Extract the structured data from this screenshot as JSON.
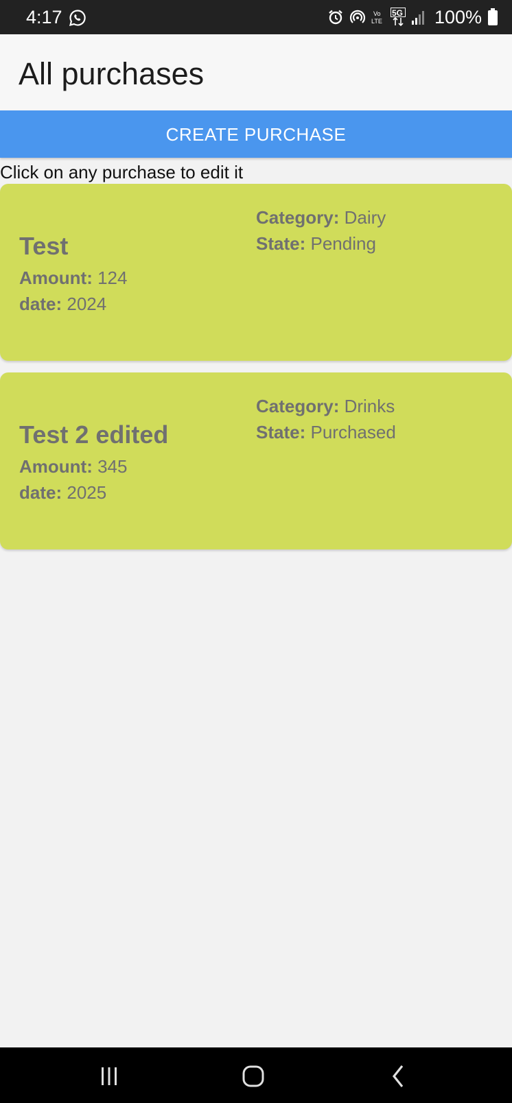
{
  "status_bar": {
    "time": "4:17",
    "battery_text": "100%",
    "icons": [
      "whatsapp-icon",
      "alarm-icon",
      "hotspot-icon",
      "volte-icon",
      "5g-icon",
      "signal-icon",
      "battery-icon"
    ]
  },
  "header": {
    "title": "All purchases"
  },
  "actions": {
    "create_label": "CREATE PURCHASE"
  },
  "hint": "Click on any purchase to edit it",
  "labels": {
    "amount": "Amount:",
    "date": "date:",
    "category": "Category:",
    "state": "State:"
  },
  "purchases": [
    {
      "name": "Test",
      "amount": "124",
      "date": "2024",
      "category": "Dairy",
      "state": "Pending"
    },
    {
      "name": "Test 2 edited",
      "amount": "345",
      "date": "2025",
      "category": "Drinks",
      "state": "Purchased"
    }
  ],
  "colors": {
    "status_bar": "#222222",
    "app_bar": "#f7f7f7",
    "accent_button": "#4a96ee",
    "card_background": "#d0dc5a",
    "card_text": "#707070",
    "page_background": "#f2f2f2"
  },
  "nav_bar": {
    "icons": [
      "recent-apps-icon",
      "home-icon",
      "back-icon"
    ]
  }
}
